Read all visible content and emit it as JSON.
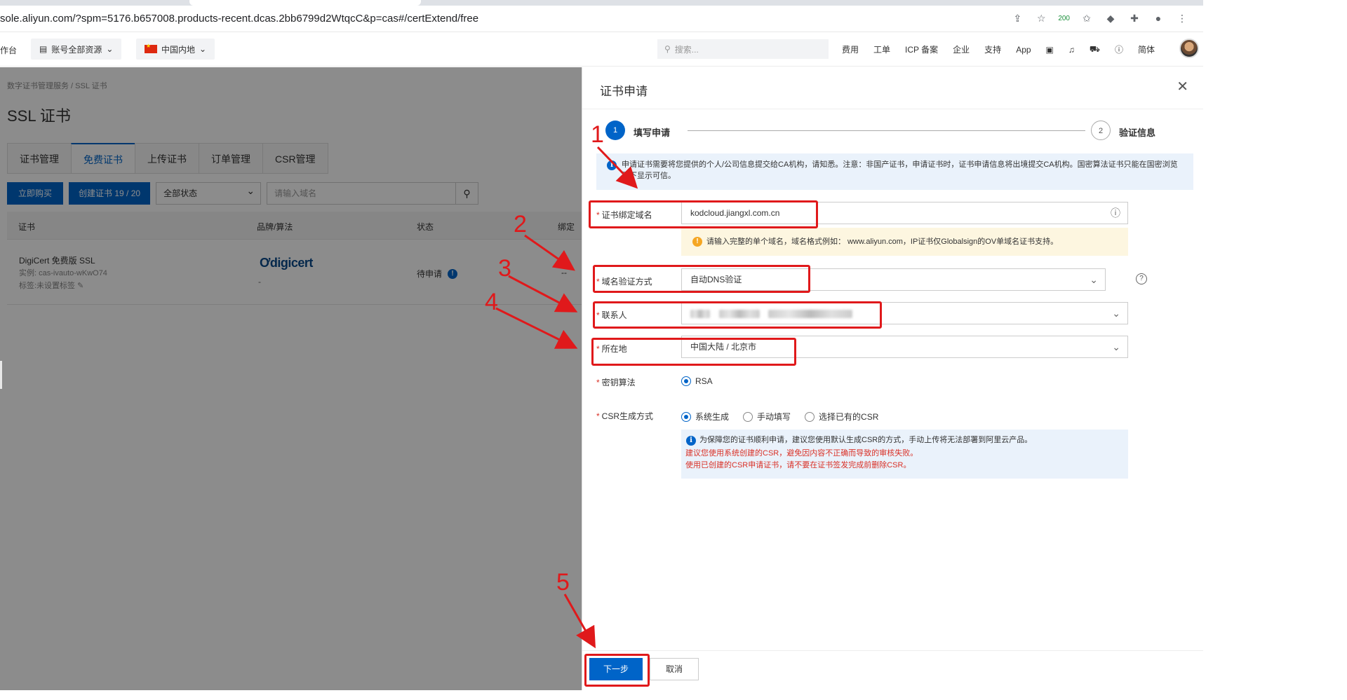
{
  "browser": {
    "url": "sole.aliyun.com/?spm=5176.b657008.products-recent.dcas.2bb6799d2WtqcC&p=cas#/certExtend/free",
    "badge": "200"
  },
  "topnav": {
    "left_fragment": "作台",
    "account_scope": "账号全部资源",
    "region": "中国内地",
    "search_placeholder": "搜索...",
    "links": [
      "费用",
      "工单",
      "ICP 备案",
      "企业",
      "支持",
      "App"
    ],
    "lang": "简体"
  },
  "background_page": {
    "breadcrumb": "数字证书管理服务  /  SSL 证书",
    "title": "SSL 证书",
    "tabs": [
      "证书管理",
      "免费证书",
      "上传证书",
      "订单管理",
      "CSR管理"
    ],
    "buy_button": "立即购买",
    "create_button": "创建证书 19 / 20",
    "status_filter": "全部状态",
    "domain_placeholder": "请输入域名",
    "columns": [
      "证书",
      "品牌/算法",
      "状态",
      "绑定"
    ],
    "row": {
      "name": "DigiCert 免费版 SSL",
      "instance": "实例: cas-ivauto-wKwO74",
      "tag": "标签:未设置标签",
      "brand": "digicert",
      "algo": "-",
      "status": "待申请",
      "bind": "--"
    }
  },
  "drawer": {
    "title": "证书申请",
    "step1": "填写申请",
    "step1_num": "1",
    "step2": "验证信息",
    "step2_num": "2",
    "notice": "申请证书需要将您提供的个人/公司信息提交给CA机构，请知悉。注意：非国产证书，申请证书时，证书申请信息将出境提交CA机构。国密算法证书只能在国密浏览器下显示可信。",
    "domain_label": "证书绑定域名",
    "domain_value": "kodcloud.jiangxl.com.cn",
    "domain_warning": "请输入完整的单个域名，域名格式例如： www.aliyun.com，IP证书仅Globalsign的OV单域名证书支持。",
    "verify_label": "域名验证方式",
    "verify_value": "自动DNS验证",
    "contact_label": "联系人",
    "location_label": "所在地",
    "location_value": "中国大陆 / 北京市",
    "key_label": "密钥算法",
    "key_option": "RSA",
    "csr_label": "CSR生成方式",
    "csr_options": [
      "系统生成",
      "手动填写",
      "选择已有的CSR"
    ],
    "csr_note": "为保障您的证书顺利申请，建议您使用默认生成CSR的方式，手动上传将无法部署到阿里云产品。",
    "csr_warn1": "建议您使用系统创建的CSR，避免因内容不正确而导致的审核失败。",
    "csr_warn2": "使用已创建的CSR申请证书，请不要在证书签发完成前删除CSR。",
    "next_button": "下一步",
    "cancel_button": "取消"
  },
  "annotations": [
    "1",
    "2",
    "3",
    "4",
    "5"
  ],
  "colors": {
    "primary": "#0064c8",
    "annotation": "#e0191b",
    "warning_bg": "#fdf6e0",
    "info_bg": "#eaf2fb"
  }
}
